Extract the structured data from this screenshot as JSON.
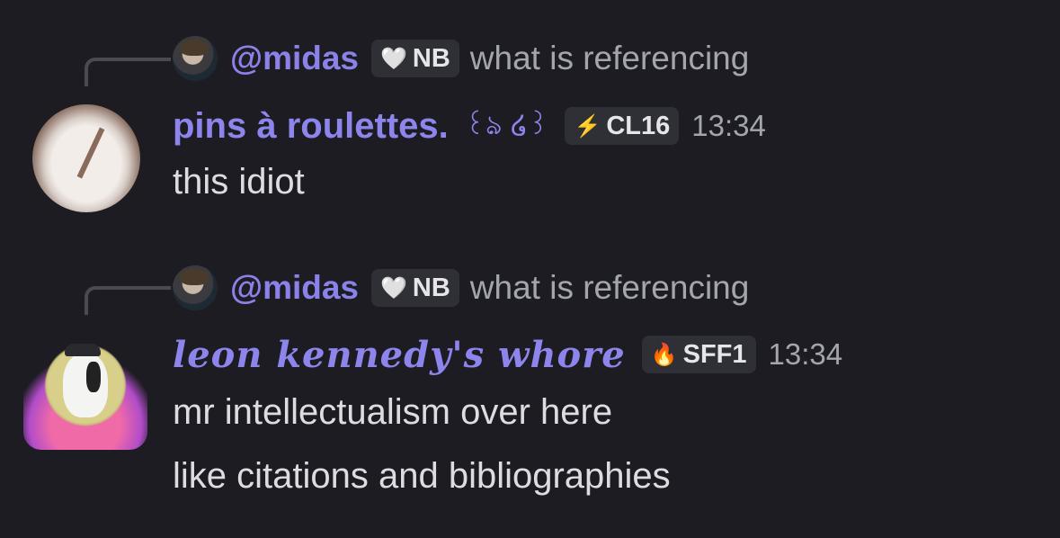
{
  "messages": [
    {
      "reply": {
        "username": "@midas",
        "tag": "NB",
        "tag_icon": "heart-icon",
        "text": "what is referencing"
      },
      "author": "pins à roulettes.",
      "author_deco": "꒰ঌ ໒꒱",
      "tag": "CL16",
      "tag_icon": "lightning-icon",
      "time": "13:34",
      "lines": [
        "this idiot"
      ]
    },
    {
      "reply": {
        "username": "@midas",
        "tag": "NB",
        "tag_icon": "heart-icon",
        "text": "what is referencing"
      },
      "author": "leon kennedy's whore",
      "tag": "SFF1",
      "tag_icon": "fire-icon",
      "time": "13:34",
      "lines": [
        "mr intellectualism over here",
        "like citations and bibliographies"
      ]
    }
  ],
  "colors": {
    "background": "#1c1c22",
    "username": "#8d85ec",
    "muted": "#a4a6ad",
    "text": "#dcdde1",
    "tag_bg": "#2f3036"
  }
}
